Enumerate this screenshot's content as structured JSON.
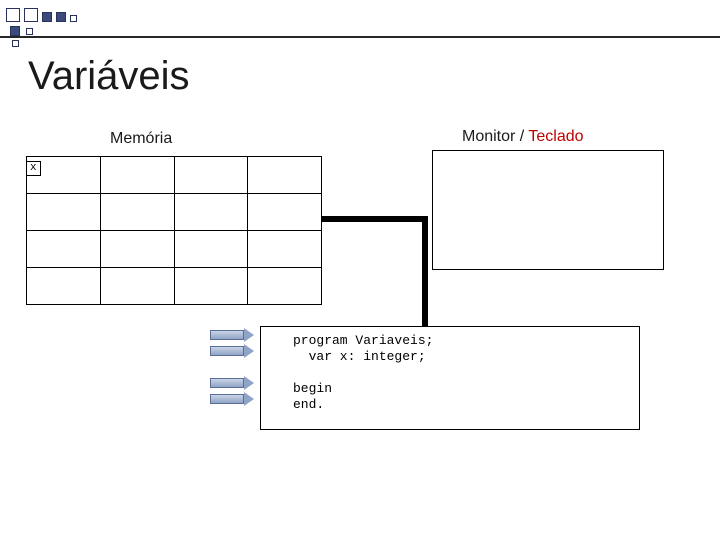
{
  "title": "Variáveis",
  "labels": {
    "memoria": "Memória",
    "monitor_prefix": "Monitor / ",
    "teclado": "Teclado"
  },
  "memory": {
    "rows": 4,
    "cols": 4,
    "cells": [
      {
        "row": 0,
        "col": 0,
        "label": "x"
      }
    ]
  },
  "code": {
    "line1": "program Variaveis;",
    "line2": "  var x: integer;",
    "line3": "",
    "line4": "begin",
    "line5": "end."
  },
  "pointers": [
    {
      "target_line": 1
    },
    {
      "target_line": 2
    },
    {
      "target_line": 4
    },
    {
      "target_line": 5
    }
  ]
}
